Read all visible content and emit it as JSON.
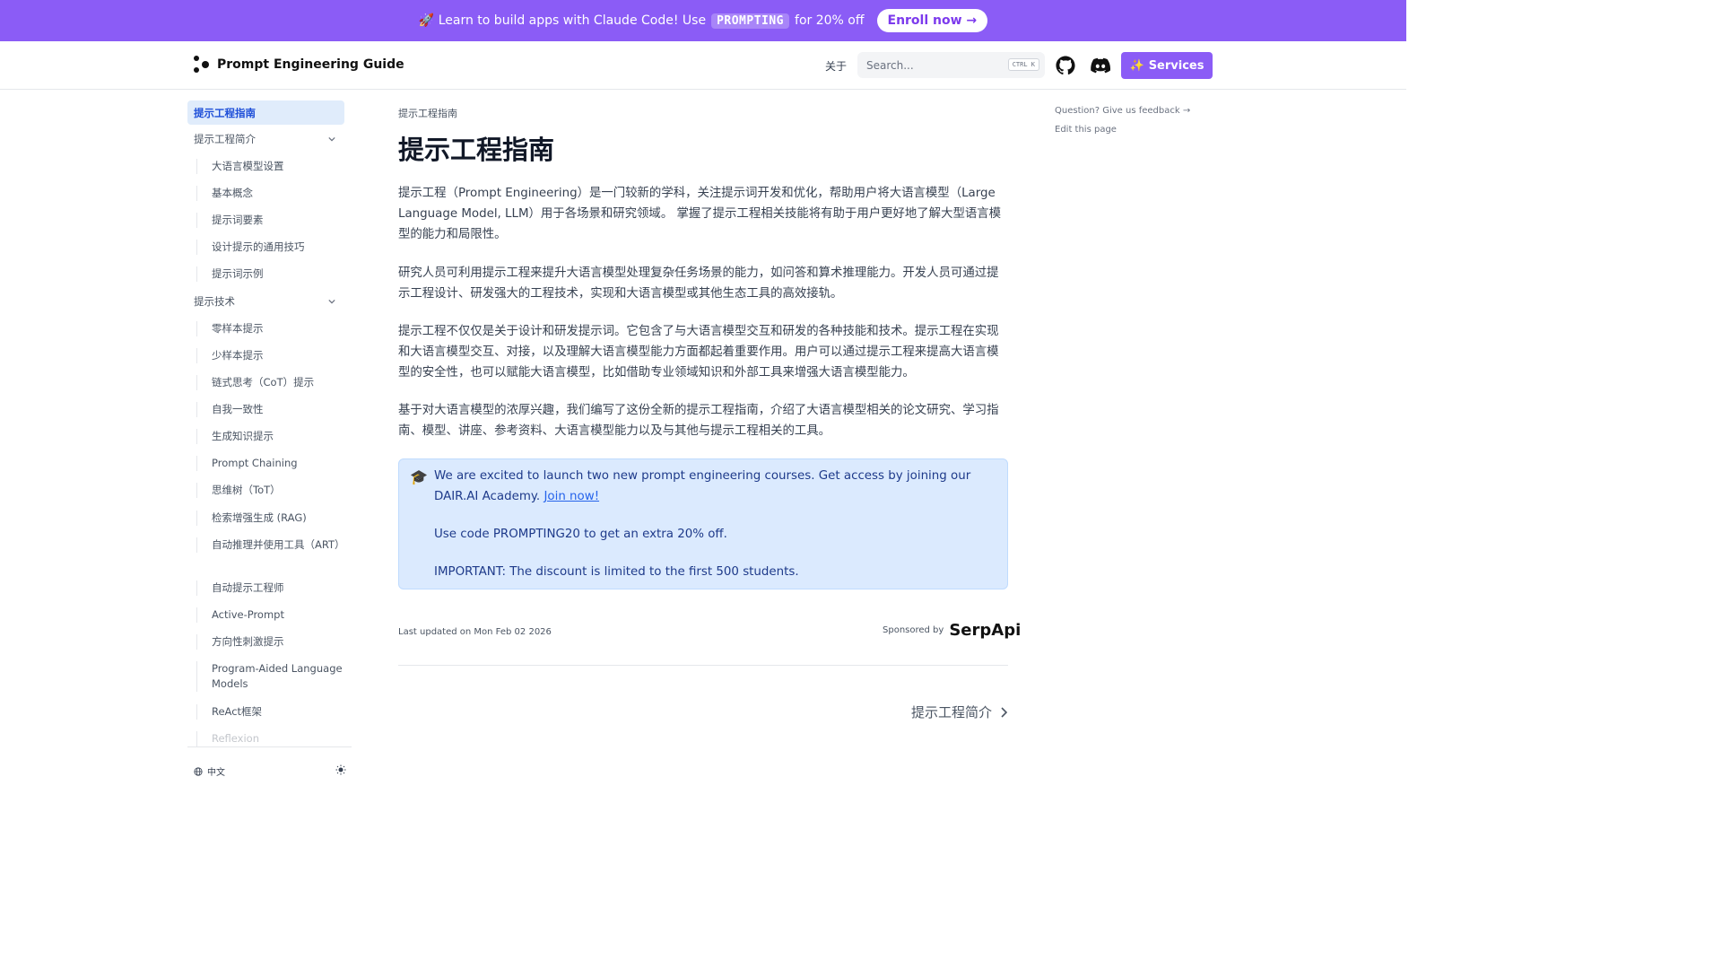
{
  "banner": {
    "prefix": "🚀 Learn to build apps with Claude Code! Use",
    "code": "PROMPTING",
    "suffix": "for 20% off",
    "cta": "Enroll now →"
  },
  "navbar": {
    "site_title": "Prompt Engineering Guide",
    "about": "关于",
    "search_placeholder": "Search...",
    "search_shortcut": "CTRL K",
    "services": "Services"
  },
  "sidebar": {
    "active": "提示工程指南",
    "groups": [
      {
        "label": "提示工程简介",
        "items": [
          "大语言模型设置",
          "基本概念",
          "提示词要素",
          "设计提示的通用技巧",
          "提示词示例"
        ]
      },
      {
        "label": "提示技术",
        "items": [
          "零样本提示",
          "少样本提示",
          "链式思考（CoT）提示",
          "自我一致性",
          "生成知识提示",
          "Prompt Chaining",
          "思维树（ToT）",
          "检索增强生成 (RAG)",
          "自动推理并使用工具（ART）",
          "自动提示工程师",
          "Active-Prompt",
          "方向性刺激提示",
          "Program-Aided Language Models",
          "ReAct框架",
          "Reflexion"
        ]
      }
    ],
    "language": "中文"
  },
  "main": {
    "breadcrumb": "提示工程指南",
    "title": "提示工程指南",
    "paragraphs": [
      "提示工程（Prompt Engineering）是一门较新的学科，关注提示词开发和优化，帮助用户将大语言模型（Large Language Model, LLM）用于各场景和研究领域。 掌握了提示工程相关技能将有助于用户更好地了解大型语言模型的能力和局限性。",
      "研究人员可利用提示工程来提升大语言模型处理复杂任务场景的能力，如问答和算术推理能力。开发人员可通过提示工程设计、研发强大的工程技术，实现和大语言模型或其他生态工具的高效接轨。",
      "提示工程不仅仅是关于设计和研发提示词。它包含了与大语言模型交互和研发的各种技能和技术。提示工程在实现和大语言模型交互、对接，以及理解大语言模型能力方面都起着重要作用。用户可以通过提示工程来提高大语言模型的安全性，也可以赋能大语言模型，比如借助专业领域知识和外部工具来增强大语言模型能力。",
      "基于对大语言模型的浓厚兴趣，我们编写了这份全新的提示工程指南，介绍了大语言模型相关的论文研究、学习指南、模型、讲座、参考资料、大语言模型能力以及与其他与提示工程相关的工具。"
    ],
    "callout": {
      "emoji": "🎓",
      "line1": "We are excited to launch two new prompt engineering courses. Get access by joining our DAIR.AI Academy.",
      "link": "Join now!",
      "line2": "Use code PROMPTING20 to get an extra 20% off.",
      "line3": "IMPORTANT: The discount is limited to the first 500 students."
    },
    "last_updated": "Last updated on Mon Feb 02 2026",
    "sponsored_by": "Sponsored by",
    "sponsor_brand": "SerpApi",
    "next_page": "提示工程简介"
  },
  "toc": {
    "feedback": "Question? Give us feedback →",
    "edit": "Edit this page"
  },
  "colors": {
    "accent": "#8b5cf6",
    "active_bg": "#e0ecfb",
    "callout_bg": "#dbeafe",
    "link": "#2563eb"
  }
}
